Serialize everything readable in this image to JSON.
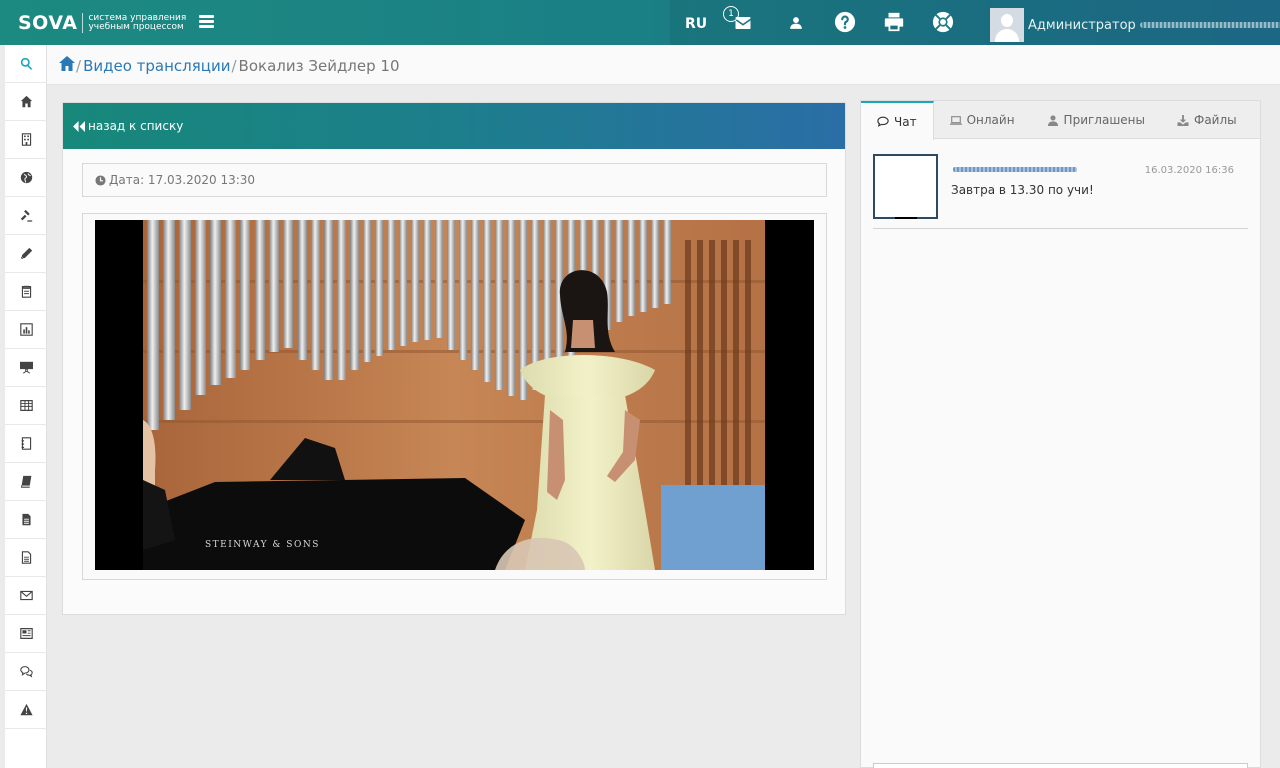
{
  "header": {
    "logo_word": "SOVA",
    "logo_subtitle": "система управления учебным процессом",
    "language": "RU",
    "mail_badge": "1",
    "user_name": "Администратор"
  },
  "sidebar": {
    "items": [
      "search-icon",
      "home-icon",
      "building-icon",
      "globe-icon",
      "gavel-icon",
      "pencil-icon",
      "clipboard-icon",
      "bar-chart-icon",
      "presentation-icon",
      "table-icon",
      "book-icon",
      "book-icon",
      "file-text-icon",
      "file-icon",
      "envelope-icon",
      "newspaper-icon",
      "comments-icon",
      "warning-icon"
    ]
  },
  "breadcrumb": {
    "link": "Видео трансляции",
    "current": "Вокализ Зейдлер 10"
  },
  "panel": {
    "back_label": "назад к списку",
    "date_label": "Дата: 17.03.2020 13:30",
    "video_caption": "STEINWAY & SONS"
  },
  "chat": {
    "tabs": [
      {
        "label": "Чат",
        "icon": "comment-icon"
      },
      {
        "label": "Онлайн",
        "icon": "laptop-icon"
      },
      {
        "label": "Приглашены",
        "icon": "user-icon"
      },
      {
        "label": "Файлы",
        "icon": "download-icon"
      }
    ],
    "message": {
      "time": "16.03.2020 16:36",
      "text": "Завтра в 13.30 по учи!"
    }
  },
  "colors": {
    "accent": "#1aa6c0",
    "link": "#2a79b7",
    "header_start": "#1c8a80",
    "header_end": "#1f6f8e"
  }
}
